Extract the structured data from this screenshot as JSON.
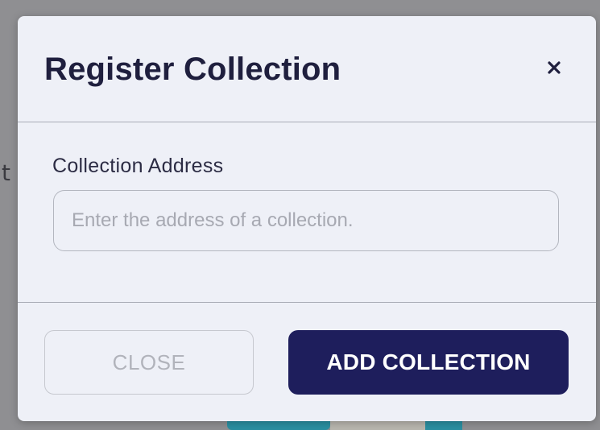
{
  "background": {
    "peek_glyph": "t"
  },
  "modal": {
    "title": "Register Collection",
    "close_icon": "close-x-icon",
    "field": {
      "label": "Collection Address",
      "value": "",
      "placeholder": "Enter the address of a collection."
    },
    "buttons": {
      "close_label": "CLOSE",
      "add_label": "ADD COLLECTION"
    }
  },
  "colors": {
    "overlay": "#8f8f92",
    "modal_bg": "#eef0f7",
    "title_text": "#1f1f3e",
    "primary_button": "#1e1e5c",
    "disabled_text": "#b1b3bb",
    "divider": "#a9acb6",
    "background_accent": "#2b8fa1"
  }
}
